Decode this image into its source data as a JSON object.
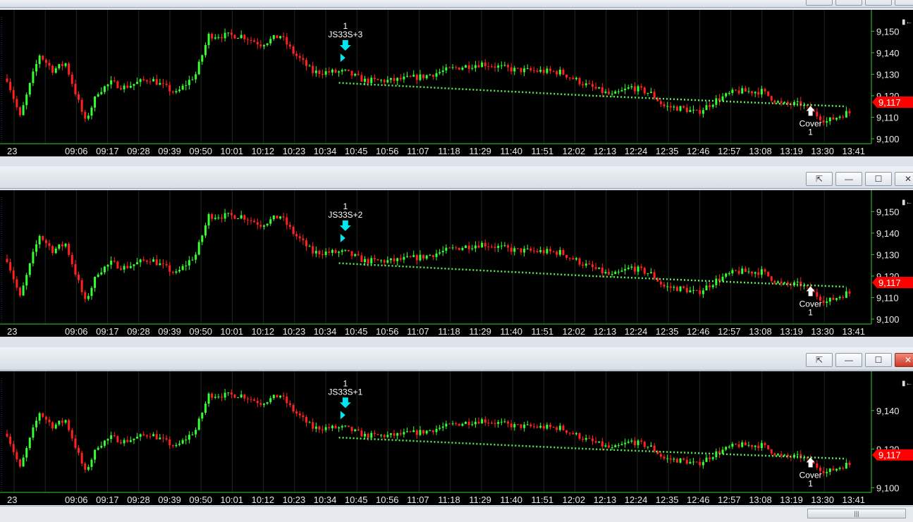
{
  "window_buttons": {
    "detach": "⇱",
    "minimize": "—",
    "maximize": "☐",
    "close": "✕"
  },
  "colors": {
    "up": "#33ff33",
    "down": "#ff2020",
    "trend": "#55ee55",
    "signal": "#00e5ee",
    "price_tag": "#ff0000",
    "grid": "#1d2a1d",
    "axis": "#2ecf2e"
  },
  "scroll_thumb": "|||",
  "panels": [
    {
      "entry_count": "1",
      "entry_label": "JS33S+3",
      "exit_label": "Cover",
      "exit_count": "1",
      "price_tag": "9,117",
      "y_ticks": [
        "9,150",
        "9,140",
        "9,130",
        "9,120",
        "9,110",
        "9,100"
      ],
      "x_ticks": [
        "23",
        "09:06",
        "09:17",
        "09:28",
        "09:39",
        "09:50",
        "10:01",
        "10:12",
        "10:23",
        "10:34",
        "10:45",
        "10:56",
        "11:07",
        "11:18",
        "11:29",
        "11:40",
        "11:51",
        "12:02",
        "12:13",
        "12:24",
        "12:35",
        "12:46",
        "12:57",
        "13:08",
        "13:19",
        "13:30",
        "13:41"
      ]
    },
    {
      "entry_count": "1",
      "entry_label": "JS33S+2",
      "exit_label": "Cover",
      "exit_count": "1",
      "price_tag": "9,117",
      "y_ticks": [
        "9,150",
        "9,140",
        "9,130",
        "9,120",
        "9,110",
        "9,100"
      ],
      "x_ticks": [
        "23",
        "09:06",
        "09:17",
        "09:28",
        "09:39",
        "09:50",
        "10:01",
        "10:12",
        "10:23",
        "10:34",
        "10:45",
        "10:56",
        "11:07",
        "11:18",
        "11:29",
        "11:40",
        "11:51",
        "12:02",
        "12:13",
        "12:24",
        "12:35",
        "12:46",
        "12:57",
        "13:08",
        "13:19",
        "13:30",
        "13:41"
      ]
    },
    {
      "entry_count": "1",
      "entry_label": "JS33S+1",
      "exit_label": "Cover",
      "exit_count": "1",
      "price_tag": "9,117",
      "y_ticks": [
        "9,140",
        "9,120",
        "9,100"
      ],
      "x_ticks": [
        "23",
        "09:06",
        "09:17",
        "09:28",
        "09:39",
        "09:50",
        "10:01",
        "10:12",
        "10:23",
        "10:34",
        "10:45",
        "10:56",
        "11:07",
        "11:18",
        "11:29",
        "11:40",
        "11:51",
        "12:02",
        "12:13",
        "12:24",
        "12:35",
        "12:46",
        "12:57",
        "13:08",
        "13:19",
        "13:30",
        "13:41"
      ]
    }
  ]
}
